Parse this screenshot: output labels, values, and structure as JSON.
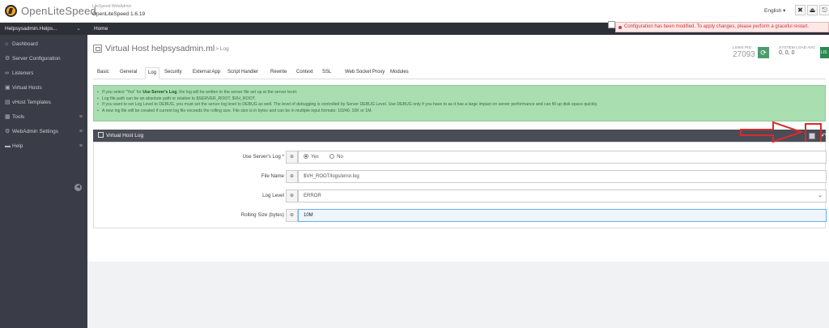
{
  "app": {
    "logo_text": "OpenLiteSpeed",
    "product_small": "LiteSpeed WebAdmin",
    "product_version": "OpenLiteSpeed 1.6.19"
  },
  "topbar": {
    "language": "English ▾",
    "btn1": "✖",
    "btn2": "⏏",
    "btn3": "⎋",
    "btn4": "↗"
  },
  "sidebar": {
    "account": "Helpsysadmin.Helps...",
    "items": [
      {
        "label": "Dashboard",
        "icon": "home-icon",
        "glyph": "⌂"
      },
      {
        "label": "Server Configuration",
        "icon": "gear-icon",
        "glyph": "⚙"
      },
      {
        "label": "Listeners",
        "icon": "link-icon",
        "glyph": "∞"
      },
      {
        "label": "Virtual Hosts",
        "icon": "monitor-icon",
        "glyph": "▣"
      },
      {
        "label": "vHost Templates",
        "icon": "template-icon",
        "glyph": "▤"
      },
      {
        "label": "Tools",
        "icon": "tools-icon",
        "glyph": "▦",
        "expandable": true
      },
      {
        "label": "WebAdmin Settings",
        "icon": "settings-icon",
        "glyph": "⚙",
        "expandable": true
      },
      {
        "label": "Help",
        "icon": "book-icon",
        "glyph": "▬",
        "expandable": true
      }
    ],
    "collapse_glyph": "◀"
  },
  "breadcrumb": {
    "home": "Home"
  },
  "notification": {
    "text": "Configuration has been modified. To apply changes, please perform a graceful restart."
  },
  "page": {
    "title": "Virtual Host helpsysadmin.ml",
    "subtitle": "> Log",
    "stats": [
      {
        "label": "LSWS PID",
        "value": "27093"
      },
      {
        "label": "SYSTEM LOAD AVG",
        "value": "0, 0, 0"
      }
    ],
    "refresh_glyph": "⟳",
    "edge_badge": "LIS"
  },
  "tabs": [
    "Basic",
    "General",
    "Log",
    "Security",
    "External App",
    "Script Handler",
    "Rewrite",
    "Context",
    "SSL",
    "Web Socket Proxy",
    "Modules"
  ],
  "active_tab": "Log",
  "info": {
    "line1_pre": "If you select \"Yes\" for ",
    "line1_bold": "Use Server's Log",
    "line1_post": ", the log will be written to the server file set up at the server level.",
    "line2": "Log file path can be an absolute path or relative to $SERVER_ROOT, $VH_ROOT.",
    "line3": "If you want to set Log Level to DEBUG, you must set the server log level to DEBUG as well. The level of debugging is controlled by Server DEBUG Level. Use DEBUG only if you have to as it has a large impact on server performance and can fill up disk space quickly.",
    "line4": "A new log file will be created if current log file exceeds the rolling size. File size is in bytes and can be in multiple input formats: 10240, 10K or 1M."
  },
  "section": {
    "title": "Virtual Host Log"
  },
  "form": {
    "use_server_log": {
      "label": "Use Server's Log *",
      "yes": "Yes",
      "no": "No",
      "selected": "Yes"
    },
    "file_name": {
      "label": "File Name",
      "value": "$VH_ROOT/logs/error.log"
    },
    "log_level": {
      "label": "Log Level",
      "value": "ERROR"
    },
    "rolling_size": {
      "label": "Rolling Size (bytes)",
      "value": "10M"
    }
  },
  "colors": {
    "sidebar": "#3a3d47",
    "accent_green": "#4f9a6d",
    "info_bg": "#a9deb0",
    "annotation_red": "#d72c2c"
  }
}
